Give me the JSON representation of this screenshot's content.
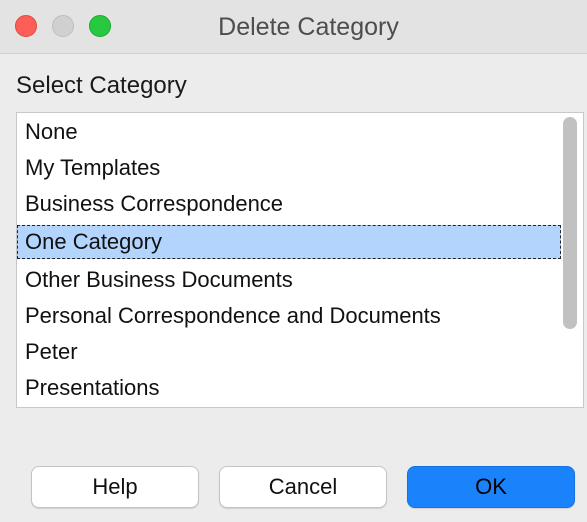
{
  "window": {
    "title": "Delete Category"
  },
  "dialog": {
    "section_label": "Select Category",
    "items": [
      {
        "label": "None"
      },
      {
        "label": "My Templates"
      },
      {
        "label": "Business Correspondence"
      },
      {
        "label": "One Category"
      },
      {
        "label": "Other Business Documents"
      },
      {
        "label": "Personal Correspondence and Documents"
      },
      {
        "label": "Peter"
      },
      {
        "label": "Presentations"
      }
    ],
    "selected_item": "One Category"
  },
  "buttons": {
    "help_label": "Help",
    "cancel_label": "Cancel",
    "ok_label": "OK"
  },
  "colors": {
    "selection": "#b3d5fd",
    "primary_button": "#1a82fb",
    "close_light": "#fc5f57",
    "maximize_light": "#28c840"
  }
}
